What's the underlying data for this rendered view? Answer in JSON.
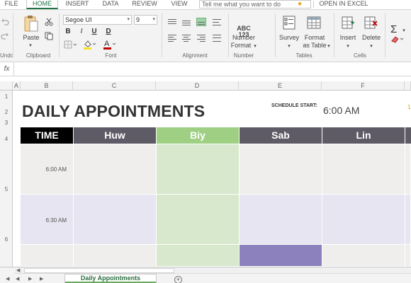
{
  "menu": {
    "file": "FILE",
    "home": "HOME",
    "insert": "INSERT",
    "data": "DATA",
    "review": "REVIEW",
    "view": "VIEW",
    "tell_me": "Tell me what you want to do",
    "open_in_excel": "OPEN IN EXCEL"
  },
  "ribbon": {
    "undo_group": "Undo",
    "clipboard": {
      "paste": "Paste",
      "group": "Clipboard"
    },
    "font": {
      "name": "Segoe UI",
      "size": "9",
      "bold": "B",
      "italic": "I",
      "underline": "U",
      "double_underline": "D",
      "group": "Font"
    },
    "alignment": {
      "group": "Alignment"
    },
    "number": {
      "icon_text": "ABC\n123",
      "label_line1": "Number",
      "label_line2": "Format",
      "group": "Number"
    },
    "tables": {
      "survey": "Survey",
      "format_line1": "Format",
      "format_line2": "as Table",
      "group": "Tables"
    },
    "cells": {
      "insert": "Insert",
      "delete": "Delete",
      "group": "Cells"
    },
    "editing": {
      "sigma": "Σ"
    }
  },
  "formula_bar": {
    "fx": "fx",
    "value": ""
  },
  "sheet": {
    "columns": [
      "A",
      "B",
      "C",
      "D",
      "E",
      "F"
    ],
    "rows": [
      "1",
      "2",
      "3",
      "4",
      "5",
      "6"
    ],
    "title": "DAILY APPOINTMENTS",
    "schedule_start_label": "SCHEDULE START:",
    "schedule_start_value": "6:00 AM",
    "schedule_partial": "1",
    "headers": {
      "time": "TIME",
      "people": [
        "Huw",
        "Biy",
        "Sab",
        "Lin"
      ]
    },
    "times": [
      "6:00 AM",
      "6:30 AM"
    ],
    "colors": {
      "time_header": "#000000",
      "person_header": "#5e5b66",
      "biy_header": "#9ecf83",
      "row_gray": "#efeeec",
      "row_lavender": "#e6e5f1",
      "biy_column": "#d8e8cc",
      "booked": "#8c80bd"
    }
  },
  "tabs": {
    "active": "Daily Appointments",
    "add": "+"
  }
}
